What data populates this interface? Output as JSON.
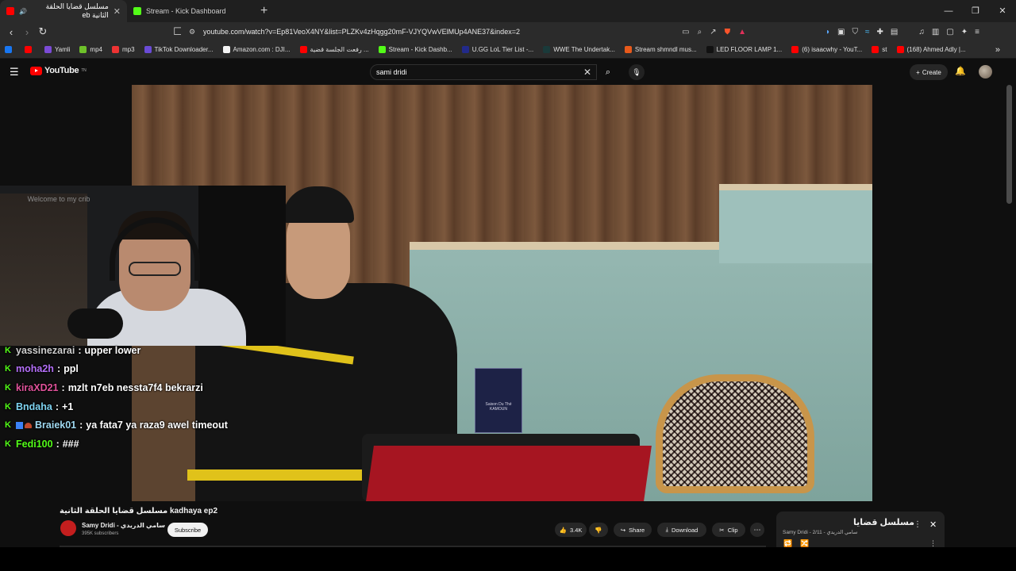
{
  "browser": {
    "tabs": [
      {
        "title": "مسلسل قضايا الحلقة الثانية eb",
        "favicon_color": "#ff0000",
        "active": true
      },
      {
        "title": "Stream - Kick Dashboard",
        "favicon_color": "#53fc18",
        "active": false
      }
    ],
    "new_tab": "+",
    "url": "youtube.com/watch?v=Ep81VeoX4NY&list=PLZKv4zHqgg20mF-VJYQVwVElMUp4ANE37&index=2",
    "bookmarks": [
      {
        "label": "",
        "color": "#1877f2"
      },
      {
        "label": "",
        "color": "#ff0000"
      },
      {
        "label": "Yamli",
        "color": "#7b4bd6"
      },
      {
        "label": "mp4",
        "color": "#6ec12a"
      },
      {
        "label": "mp3",
        "color": "#e33"
      },
      {
        "label": "TikTok Downloader...",
        "color": "#6a4bd6"
      },
      {
        "label": "Amazon.com : DJI...",
        "color": "#f4f4f4"
      },
      {
        "label": "رفعت الجلسة قضية ...",
        "color": "#ff0000"
      },
      {
        "label": "Stream - Kick Dashb...",
        "color": "#53fc18"
      },
      {
        "label": "U.GG LoL Tier List -...",
        "color": "#222a8a"
      },
      {
        "label": "WWE The Undertak...",
        "color": "#1a3a3a"
      },
      {
        "label": "Stream shmndl mus...",
        "color": "#e85a1b"
      },
      {
        "label": "LED FLOOR LAMP 1...",
        "color": "#111"
      },
      {
        "label": "(6) isaacwhy - YouT...",
        "color": "#ff0000"
      },
      {
        "label": "st",
        "color": "#ff0000"
      },
      {
        "label": "(168) Ahmed Adly |...",
        "color": "#ff0000"
      }
    ]
  },
  "youtube": {
    "logo_text": "YouTube",
    "logo_region": "TN",
    "search_query": "sami dridi",
    "create_label": "Create"
  },
  "stream_overlay": {
    "welcome_text": "Welcome to my crib",
    "chat": [
      {
        "user": "yassinezarai",
        "color": "#cfcfcf",
        "message": "upper lower",
        "badges": []
      },
      {
        "user": "moha2h",
        "color": "#b36ff7",
        "message": "ppl",
        "badges": []
      },
      {
        "user": "kiraXD21",
        "color": "#e0529a",
        "message": "mzlt n7eb nessta7f4 bekrarzi",
        "badges": []
      },
      {
        "user": "Bndaha",
        "color": "#7ed3f0",
        "message": "+1",
        "badges": []
      },
      {
        "user": "Braiek01",
        "color": "#9fd8f0",
        "message": "ya fata7 ya raza9 awel timeout",
        "badges": [
          "sub",
          "gift"
        ]
      },
      {
        "user": "Fedi100",
        "color": "#53fc18",
        "message": "###",
        "badges": []
      }
    ]
  },
  "video": {
    "title": "مسلسل قضايا الحلقة الثانية kadhaya ep2",
    "channel": "Samy Dridi - سامي الدريدي",
    "subscribers": "395K subscribers",
    "subscribe_label": "Subscribe",
    "likes": "3.4K",
    "share_label": "Share",
    "download_label": "Download",
    "clip_label": "Clip",
    "tea_box_label": "Saison Du Thé KAMOUN"
  },
  "playlist": {
    "title": "مسلسل قضايا",
    "meta": "Samy Dridi - سامي الدريدي - 2/11"
  }
}
